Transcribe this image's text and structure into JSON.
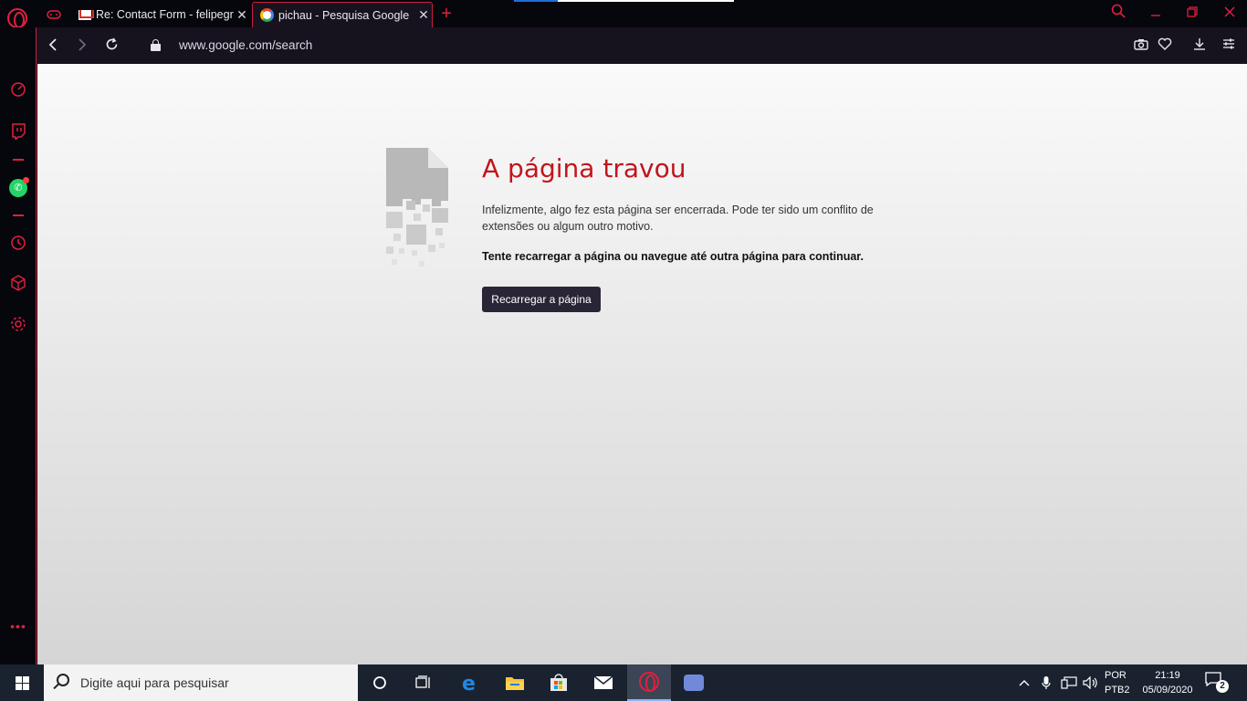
{
  "browser": {
    "tabs": [
      {
        "label": "Re: Contact Form - felipegr",
        "favicon": "gmail-icon"
      },
      {
        "label": "pichau - Pesquisa Google",
        "favicon": "google-icon",
        "active": true
      }
    ],
    "new_tab_label": "+",
    "url": "www.google.com/search",
    "accent_color": "#e0203f"
  },
  "sidebar": {
    "items": [
      "speed-dial-icon",
      "twitch-icon",
      "whatsapp-icon",
      "history-icon",
      "extensions-icon",
      "settings-icon",
      "more-icon"
    ]
  },
  "page": {
    "title": "A página travou",
    "description": "Infelizmente, algo fez esta página ser encerrada. Pode ter sido um conflito de extensões ou algum outro motivo.",
    "hint": "Tente recarregar a página ou navegue até outra página para continuar.",
    "reload_button": "Recarregar a página",
    "title_color": "#c1151c"
  },
  "taskbar": {
    "search_placeholder": "Digite aqui para pesquisar",
    "language": "POR",
    "layout": "PTB2",
    "time": "21:19",
    "date": "05/09/2020",
    "notification_count": "2"
  }
}
